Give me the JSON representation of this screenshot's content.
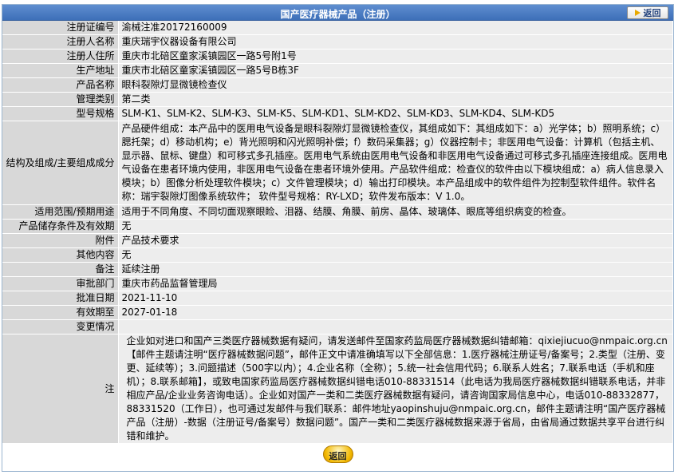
{
  "header": {
    "title": "国产医疗器械产品（注册）",
    "back_label": "返回"
  },
  "rows": [
    {
      "label": "注册证编号",
      "value": "渝械注准20172160009"
    },
    {
      "label": "注册人名称",
      "value": "重庆瑞宇仪器设备有限公司"
    },
    {
      "label": "注册人住所",
      "value": "重庆市北碚区童家溪镇园区一路5号附1号"
    },
    {
      "label": "生产地址",
      "value": "重庆市北碚区童家溪镇园区一路5号B栋3F"
    },
    {
      "label": "产品名称",
      "value": "眼科裂隙灯显微镜检查仪"
    },
    {
      "label": "管理类别",
      "value": "第二类"
    },
    {
      "label": "型号规格",
      "value": "SLM-K1、SLM-K2、SLM-K3、SLM-K5、SLM-KD1、SLM-KD2、SLM-KD3、SLM-KD4、SLM-KD5"
    },
    {
      "label": "结构及组成/主要组成成分",
      "value": "产品硬件组成：本产品中的医用电气设备是眼科裂隙灯显微镜检查仪，其组成如下：其组成如下：a）光学体；b）照明系统；c）腮托架；d）移动机构；e）背光照明和闪光照明补偿；f）数码采集器；g）仪器控制卡；非医用电气设备：计算机（包括主机、显示器、鼠标、键盘）和可移式多孔插座。医用电气系统由医用电气设备和非医用电气设备通过可移式多孔插座连接组成。医用电气设备在患者环境内使用，非医用电气设备在患者环境外使用。产品软件组成：检查仪的软件由以下模块组成：a）病人信息录入模块；b）图像分析处理软件模块；c）文件管理模块；d）输出打印模块。本产品组成中的软件组件为控制型软件组件。软件名称：瑞宇裂隙灯图像系统软件； 软件型号规格：RY-LXD；软件发布版本：V 1.0。"
    },
    {
      "label": "适用范围/预期用途",
      "value": "适用于不同角度、不同切面观察眼睑、泪器、结膜、角膜、前房、晶体、玻璃体、眼底等组织病变的检查。"
    },
    {
      "label": "产品储存条件及有效期",
      "value": "无"
    },
    {
      "label": "附件",
      "value": "产品技术要求"
    },
    {
      "label": "其他内容",
      "value": "无"
    },
    {
      "label": "备注",
      "value": "延续注册"
    },
    {
      "label": "审批部门",
      "value": "重庆市药品监督管理局"
    },
    {
      "label": "批准日期",
      "value": "2021-11-10"
    },
    {
      "label": "有效期至",
      "value": "2027-01-18"
    },
    {
      "label": "变更情况",
      "value": ""
    },
    {
      "label": "注",
      "value": "企业如对进口和国产三类医疗器械数据有疑问，请发送邮件至国家药监局医疗器械数据纠错邮箱：qixiejiucuo@nmpaic.org.cn【邮件主题请注明“医疗器械数据问题”，邮件正文中请准确填写以下全部信息：1.医疗器械注册证号/备案号；2.类型（注册、变更、延续等）；3.问题描述（500字以内）；4.企业名称（全称）；5.统一社会信用代码；6.联系人姓名；7.联系电话（手机和座机）；8.联系邮箱】，或致电国家药监局医疗器械数据纠错电话010-88331514（此电话为我局医疗器械数据纠错联系电话，并非相应产品/企业业务咨询电话）。企业如对国产一类和二类医疗器械数据有疑问，请咨询国家局信息中心，电话010-88332877，88331520（工作日），也可通过发邮件与我们联系：邮件地址yaopinshuju@nmpaic.org.cn，邮件主题请注明“国产医疗器械产品（注册）-数据（注册证号/备案号）数据问题”。国产一类和二类医疗器械数据来源于省局，由省局通过数据共享平台进行纠错和维护。"
    }
  ],
  "footer": {
    "back_label": "返回"
  }
}
